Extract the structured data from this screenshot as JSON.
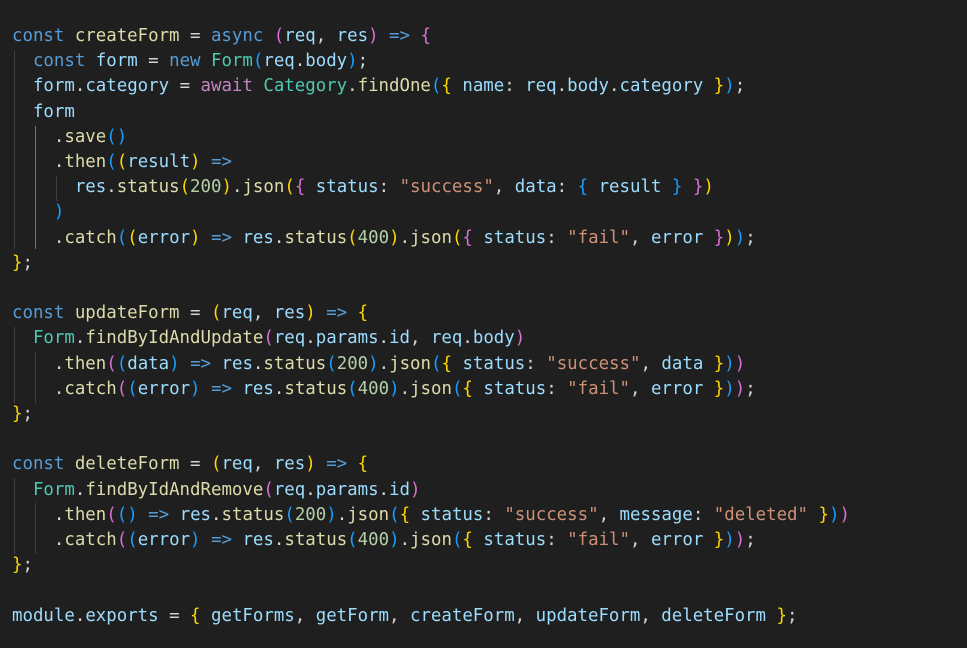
{
  "colors": {
    "background": "#1f1f1f",
    "keyword": "#569cd6",
    "control": "#c586c0",
    "variable": "#9cdcfe",
    "function": "#dcdcaa",
    "class": "#4ec9b0",
    "string": "#ce9178",
    "number": "#b5cea8",
    "punctuation": "#d4d4d4",
    "bracket1": "#ffd700",
    "bracket2": "#da70d6",
    "bracket3": "#179fff"
  },
  "code": {
    "lines": [
      [
        [
          "k",
          "const "
        ],
        [
          "f",
          "createForm"
        ],
        [
          "p",
          " = "
        ],
        [
          "k",
          "async "
        ],
        [
          "b2",
          "("
        ],
        [
          "v",
          "req"
        ],
        [
          "p",
          ", "
        ],
        [
          "v",
          "res"
        ],
        [
          "b2",
          ")"
        ],
        [
          "k",
          " =>"
        ],
        [
          "p",
          " "
        ],
        [
          "b2",
          "{"
        ]
      ],
      [
        [
          "p",
          "  "
        ],
        [
          "k",
          "const "
        ],
        [
          "v",
          "form"
        ],
        [
          "p",
          " = "
        ],
        [
          "k",
          "new "
        ],
        [
          "c",
          "Form"
        ],
        [
          "b3",
          "("
        ],
        [
          "v",
          "req"
        ],
        [
          "p",
          "."
        ],
        [
          "v",
          "body"
        ],
        [
          "b3",
          ")"
        ],
        [
          "p",
          ";"
        ]
      ],
      [
        [
          "p",
          "  "
        ],
        [
          "v",
          "form"
        ],
        [
          "p",
          "."
        ],
        [
          "v",
          "category"
        ],
        [
          "p",
          " = "
        ],
        [
          "ct",
          "await "
        ],
        [
          "c",
          "Category"
        ],
        [
          "p",
          "."
        ],
        [
          "f",
          "findOne"
        ],
        [
          "b3",
          "("
        ],
        [
          "b1",
          "{"
        ],
        [
          "p",
          " "
        ],
        [
          "v",
          "name"
        ],
        [
          "p",
          ": "
        ],
        [
          "v",
          "req"
        ],
        [
          "p",
          "."
        ],
        [
          "v",
          "body"
        ],
        [
          "p",
          "."
        ],
        [
          "v",
          "category"
        ],
        [
          "p",
          " "
        ],
        [
          "b1",
          "}"
        ],
        [
          "b3",
          ")"
        ],
        [
          "p",
          ";"
        ]
      ],
      [
        [
          "p",
          "  "
        ],
        [
          "v",
          "form"
        ]
      ],
      [
        [
          "p",
          "    ."
        ],
        [
          "f",
          "save"
        ],
        [
          "b3",
          "()"
        ]
      ],
      [
        [
          "p",
          "    ."
        ],
        [
          "f",
          "then"
        ],
        [
          "b3",
          "("
        ],
        [
          "b1",
          "("
        ],
        [
          "v",
          "result"
        ],
        [
          "b1",
          ")"
        ],
        [
          "k",
          " =>"
        ]
      ],
      [
        [
          "p",
          "      "
        ],
        [
          "v",
          "res"
        ],
        [
          "p",
          "."
        ],
        [
          "f",
          "status"
        ],
        [
          "b1",
          "("
        ],
        [
          "n",
          "200"
        ],
        [
          "b1",
          ")"
        ],
        [
          "p",
          "."
        ],
        [
          "f",
          "json"
        ],
        [
          "b1",
          "("
        ],
        [
          "b2",
          "{"
        ],
        [
          "p",
          " "
        ],
        [
          "v",
          "status"
        ],
        [
          "p",
          ": "
        ],
        [
          "s",
          "\"success\""
        ],
        [
          "p",
          ", "
        ],
        [
          "v",
          "data"
        ],
        [
          "p",
          ": "
        ],
        [
          "b3",
          "{"
        ],
        [
          "p",
          " "
        ],
        [
          "v",
          "result"
        ],
        [
          "p",
          " "
        ],
        [
          "b3",
          "}"
        ],
        [
          "p",
          " "
        ],
        [
          "b2",
          "}"
        ],
        [
          "b1",
          ")"
        ]
      ],
      [
        [
          "p",
          "    "
        ],
        [
          "b3",
          ")"
        ]
      ],
      [
        [
          "p",
          "    ."
        ],
        [
          "f",
          "catch"
        ],
        [
          "b3",
          "("
        ],
        [
          "b1",
          "("
        ],
        [
          "v",
          "error"
        ],
        [
          "b1",
          ")"
        ],
        [
          "k",
          " =>"
        ],
        [
          "p",
          " "
        ],
        [
          "v",
          "res"
        ],
        [
          "p",
          "."
        ],
        [
          "f",
          "status"
        ],
        [
          "b1",
          "("
        ],
        [
          "n",
          "400"
        ],
        [
          "b1",
          ")"
        ],
        [
          "p",
          "."
        ],
        [
          "f",
          "json"
        ],
        [
          "b1",
          "("
        ],
        [
          "b2",
          "{"
        ],
        [
          "p",
          " "
        ],
        [
          "v",
          "status"
        ],
        [
          "p",
          ": "
        ],
        [
          "s",
          "\"fail\""
        ],
        [
          "p",
          ", "
        ],
        [
          "v",
          "error"
        ],
        [
          "p",
          " "
        ],
        [
          "b2",
          "}"
        ],
        [
          "b1",
          ")"
        ],
        [
          "b3",
          ")"
        ],
        [
          "p",
          ";"
        ]
      ],
      [
        [
          "b1",
          "}"
        ],
        [
          "p",
          ";"
        ]
      ],
      [],
      [
        [
          "k",
          "const "
        ],
        [
          "f",
          "updateForm"
        ],
        [
          "p",
          " = "
        ],
        [
          "b1",
          "("
        ],
        [
          "v",
          "req"
        ],
        [
          "p",
          ", "
        ],
        [
          "v",
          "res"
        ],
        [
          "b1",
          ")"
        ],
        [
          "k",
          " =>"
        ],
        [
          "p",
          " "
        ],
        [
          "b1",
          "{"
        ]
      ],
      [
        [
          "p",
          "  "
        ],
        [
          "c",
          "Form"
        ],
        [
          "p",
          "."
        ],
        [
          "f",
          "findByIdAndUpdate"
        ],
        [
          "b2",
          "("
        ],
        [
          "v",
          "req"
        ],
        [
          "p",
          "."
        ],
        [
          "v",
          "params"
        ],
        [
          "p",
          "."
        ],
        [
          "v",
          "id"
        ],
        [
          "p",
          ", "
        ],
        [
          "v",
          "req"
        ],
        [
          "p",
          "."
        ],
        [
          "v",
          "body"
        ],
        [
          "b2",
          ")"
        ]
      ],
      [
        [
          "p",
          "    ."
        ],
        [
          "f",
          "then"
        ],
        [
          "b2",
          "("
        ],
        [
          "b3",
          "("
        ],
        [
          "v",
          "data"
        ],
        [
          "b3",
          ")"
        ],
        [
          "k",
          " =>"
        ],
        [
          "p",
          " "
        ],
        [
          "v",
          "res"
        ],
        [
          "p",
          "."
        ],
        [
          "f",
          "status"
        ],
        [
          "b3",
          "("
        ],
        [
          "n",
          "200"
        ],
        [
          "b3",
          ")"
        ],
        [
          "p",
          "."
        ],
        [
          "f",
          "json"
        ],
        [
          "b3",
          "("
        ],
        [
          "b1",
          "{"
        ],
        [
          "p",
          " "
        ],
        [
          "v",
          "status"
        ],
        [
          "p",
          ": "
        ],
        [
          "s",
          "\"success\""
        ],
        [
          "p",
          ", "
        ],
        [
          "v",
          "data"
        ],
        [
          "p",
          " "
        ],
        [
          "b1",
          "}"
        ],
        [
          "b3",
          ")"
        ],
        [
          "b2",
          ")"
        ]
      ],
      [
        [
          "p",
          "    ."
        ],
        [
          "f",
          "catch"
        ],
        [
          "b2",
          "("
        ],
        [
          "b3",
          "("
        ],
        [
          "v",
          "error"
        ],
        [
          "b3",
          ")"
        ],
        [
          "k",
          " =>"
        ],
        [
          "p",
          " "
        ],
        [
          "v",
          "res"
        ],
        [
          "p",
          "."
        ],
        [
          "f",
          "status"
        ],
        [
          "b3",
          "("
        ],
        [
          "n",
          "400"
        ],
        [
          "b3",
          ")"
        ],
        [
          "p",
          "."
        ],
        [
          "f",
          "json"
        ],
        [
          "b3",
          "("
        ],
        [
          "b1",
          "{"
        ],
        [
          "p",
          " "
        ],
        [
          "v",
          "status"
        ],
        [
          "p",
          ": "
        ],
        [
          "s",
          "\"fail\""
        ],
        [
          "p",
          ", "
        ],
        [
          "v",
          "error"
        ],
        [
          "p",
          " "
        ],
        [
          "b1",
          "}"
        ],
        [
          "b3",
          ")"
        ],
        [
          "b2",
          ")"
        ],
        [
          "p",
          ";"
        ]
      ],
      [
        [
          "b1",
          "}"
        ],
        [
          "p",
          ";"
        ]
      ],
      [],
      [
        [
          "k",
          "const "
        ],
        [
          "f",
          "deleteForm"
        ],
        [
          "p",
          " = "
        ],
        [
          "b1",
          "("
        ],
        [
          "v",
          "req"
        ],
        [
          "p",
          ", "
        ],
        [
          "v",
          "res"
        ],
        [
          "b1",
          ")"
        ],
        [
          "k",
          " =>"
        ],
        [
          "p",
          " "
        ],
        [
          "b1",
          "{"
        ]
      ],
      [
        [
          "p",
          "  "
        ],
        [
          "c",
          "Form"
        ],
        [
          "p",
          "."
        ],
        [
          "f",
          "findByIdAndRemove"
        ],
        [
          "b2",
          "("
        ],
        [
          "v",
          "req"
        ],
        [
          "p",
          "."
        ],
        [
          "v",
          "params"
        ],
        [
          "p",
          "."
        ],
        [
          "v",
          "id"
        ],
        [
          "b2",
          ")"
        ]
      ],
      [
        [
          "p",
          "    ."
        ],
        [
          "f",
          "then"
        ],
        [
          "b2",
          "("
        ],
        [
          "b3",
          "()"
        ],
        [
          "k",
          " =>"
        ],
        [
          "p",
          " "
        ],
        [
          "v",
          "res"
        ],
        [
          "p",
          "."
        ],
        [
          "f",
          "status"
        ],
        [
          "b3",
          "("
        ],
        [
          "n",
          "200"
        ],
        [
          "b3",
          ")"
        ],
        [
          "p",
          "."
        ],
        [
          "f",
          "json"
        ],
        [
          "b3",
          "("
        ],
        [
          "b1",
          "{"
        ],
        [
          "p",
          " "
        ],
        [
          "v",
          "status"
        ],
        [
          "p",
          ": "
        ],
        [
          "s",
          "\"success\""
        ],
        [
          "p",
          ", "
        ],
        [
          "v",
          "message"
        ],
        [
          "p",
          ": "
        ],
        [
          "s",
          "\"deleted\""
        ],
        [
          "p",
          " "
        ],
        [
          "b1",
          "}"
        ],
        [
          "b3",
          ")"
        ],
        [
          "b2",
          ")"
        ]
      ],
      [
        [
          "p",
          "    ."
        ],
        [
          "f",
          "catch"
        ],
        [
          "b2",
          "("
        ],
        [
          "b3",
          "("
        ],
        [
          "v",
          "error"
        ],
        [
          "b3",
          ")"
        ],
        [
          "k",
          " =>"
        ],
        [
          "p",
          " "
        ],
        [
          "v",
          "res"
        ],
        [
          "p",
          "."
        ],
        [
          "f",
          "status"
        ],
        [
          "b3",
          "("
        ],
        [
          "n",
          "400"
        ],
        [
          "b3",
          ")"
        ],
        [
          "p",
          "."
        ],
        [
          "f",
          "json"
        ],
        [
          "b3",
          "("
        ],
        [
          "b1",
          "{"
        ],
        [
          "p",
          " "
        ],
        [
          "v",
          "status"
        ],
        [
          "p",
          ": "
        ],
        [
          "s",
          "\"fail\""
        ],
        [
          "p",
          ", "
        ],
        [
          "v",
          "error"
        ],
        [
          "p",
          " "
        ],
        [
          "b1",
          "}"
        ],
        [
          "b3",
          ")"
        ],
        [
          "b2",
          ")"
        ],
        [
          "p",
          ";"
        ]
      ],
      [
        [
          "b1",
          "}"
        ],
        [
          "p",
          ";"
        ]
      ],
      [],
      [
        [
          "v",
          "module"
        ],
        [
          "p",
          "."
        ],
        [
          "v",
          "exports"
        ],
        [
          "p",
          " = "
        ],
        [
          "b1",
          "{"
        ],
        [
          "p",
          " "
        ],
        [
          "v",
          "getForms"
        ],
        [
          "p",
          ", "
        ],
        [
          "v",
          "getForm"
        ],
        [
          "p",
          ", "
        ],
        [
          "v",
          "createForm"
        ],
        [
          "p",
          ", "
        ],
        [
          "v",
          "updateForm"
        ],
        [
          "p",
          ", "
        ],
        [
          "v",
          "deleteForm"
        ],
        [
          "p",
          " "
        ],
        [
          "b1",
          "}"
        ],
        [
          "p",
          ";"
        ]
      ]
    ]
  }
}
